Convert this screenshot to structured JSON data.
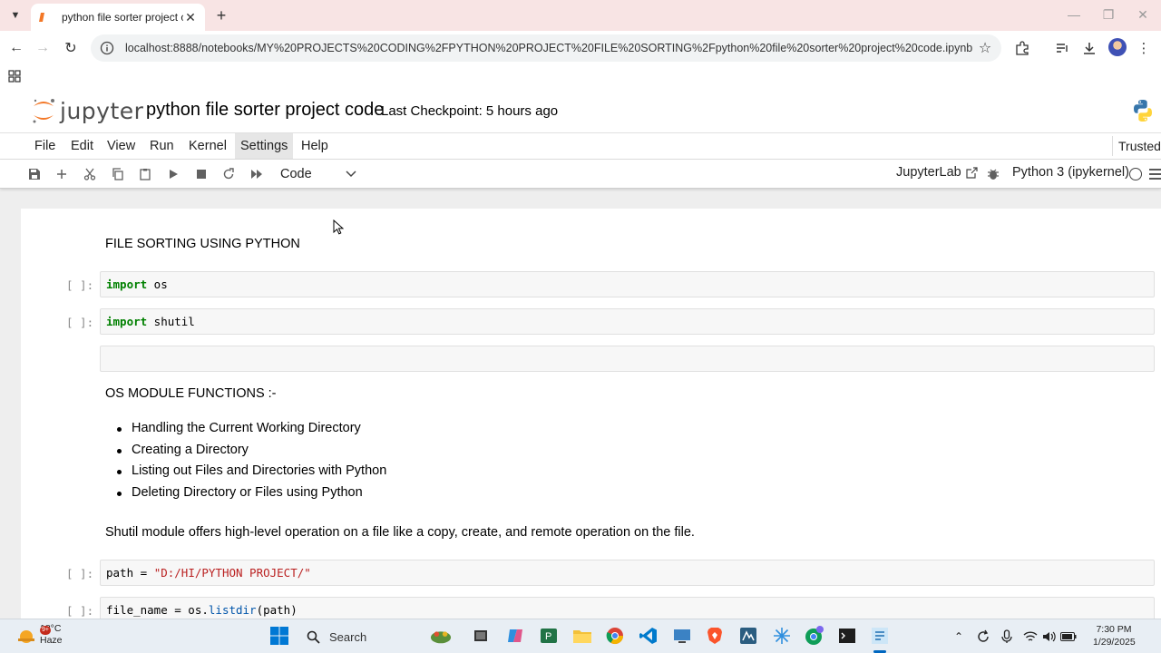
{
  "browser": {
    "tab_title": "python file sorter project code",
    "url": "localhost:8888/notebooks/MY%20PROJECTS%20CODING%2FPYTHON%20PROJECT%20FILE%20SORTING%2Fpython%20file%20sorter%20project%20code.ipynb"
  },
  "jupyter": {
    "logo_text": "jupyter",
    "notebook_title": "python file sorter project code",
    "checkpoint": "Last Checkpoint: 5 hours ago",
    "trusted": "Trusted",
    "menu": [
      "File",
      "Edit",
      "View",
      "Run",
      "Kernel",
      "Settings",
      "Help"
    ],
    "active_menu": "Settings",
    "cell_type": "Code",
    "jupyterlab_link": "JupyterLab",
    "kernel": "Python 3 (ipykernel)"
  },
  "cells": {
    "md_title": "FILE SORTING USING PYTHON",
    "prompt": "[ ]:",
    "code1_kw": "import",
    "code1_rest": " os",
    "code2_kw": "import",
    "code2_rest": " shutil",
    "md_os_heading": "OS MODULE FUNCTIONS :-",
    "md_os_items": [
      "Handling the Current Working Directory",
      "Creating a Directory",
      "Listing out Files and Directories with Python",
      "Deleting Directory or Files using Python"
    ],
    "md_shutil": "Shutil module offers high-level operation on a file like a copy, create, and remote operation on the file.",
    "code3_var": "path = ",
    "code3_str": "\"D:/HI/PYTHON PROJECT/\"",
    "code4_a": "file_name = os.",
    "code4_fn": "listdir",
    "code4_b": "(path)"
  },
  "taskbar": {
    "temp": "18°C",
    "weather": "Haze",
    "badge": "9+",
    "search": "Search",
    "time": "7:30 PM",
    "date": "1/29/2025"
  }
}
